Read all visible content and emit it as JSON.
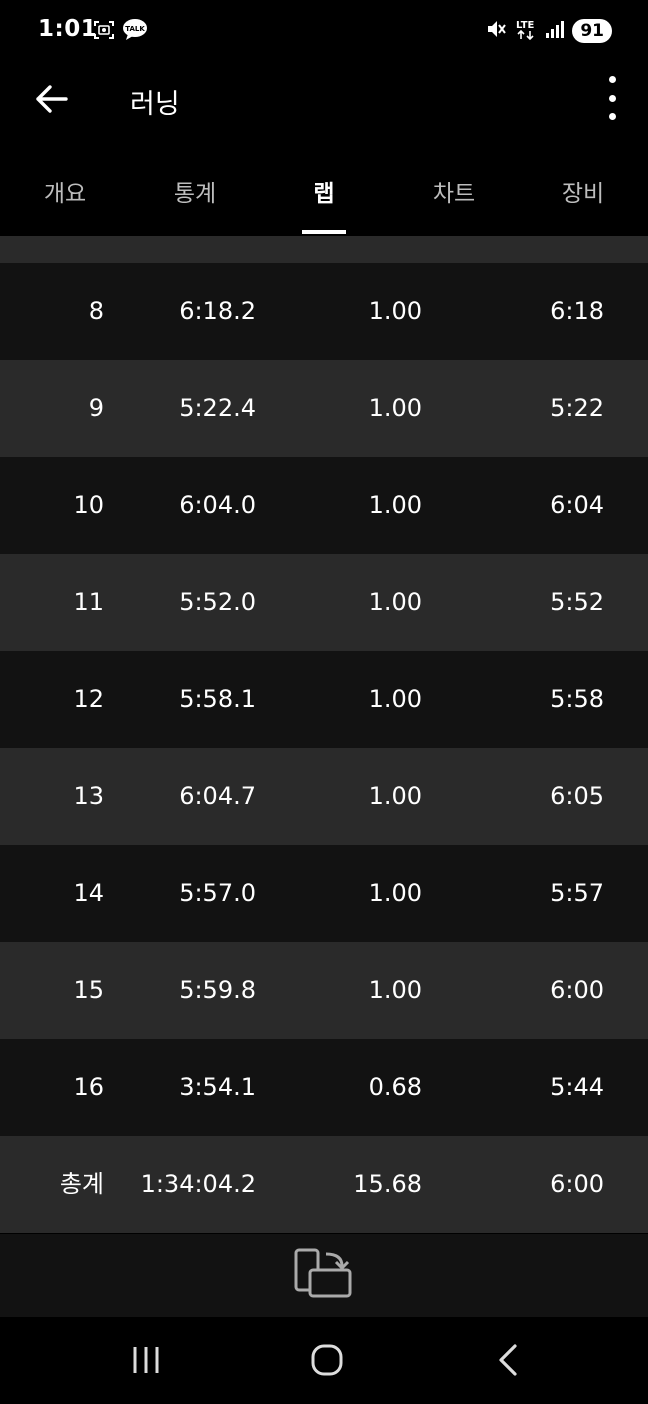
{
  "status_bar": {
    "time": "1:01",
    "battery": "91",
    "network": "LTE"
  },
  "app_bar": {
    "title": "러닝"
  },
  "tabs": [
    {
      "label": "개요",
      "active": false
    },
    {
      "label": "통계",
      "active": false
    },
    {
      "label": "랩",
      "active": true
    },
    {
      "label": "차트",
      "active": false
    },
    {
      "label": "장비",
      "active": false
    }
  ],
  "laps": [
    {
      "lap": "8",
      "time": "6:18.2",
      "distance": "1.00",
      "pace": "6:18"
    },
    {
      "lap": "9",
      "time": "5:22.4",
      "distance": "1.00",
      "pace": "5:22"
    },
    {
      "lap": "10",
      "time": "6:04.0",
      "distance": "1.00",
      "pace": "6:04"
    },
    {
      "lap": "11",
      "time": "5:52.0",
      "distance": "1.00",
      "pace": "5:52"
    },
    {
      "lap": "12",
      "time": "5:58.1",
      "distance": "1.00",
      "pace": "5:58"
    },
    {
      "lap": "13",
      "time": "6:04.7",
      "distance": "1.00",
      "pace": "6:05"
    },
    {
      "lap": "14",
      "time": "5:57.0",
      "distance": "1.00",
      "pace": "5:57"
    },
    {
      "lap": "15",
      "time": "5:59.8",
      "distance": "1.00",
      "pace": "6:00"
    },
    {
      "lap": "16",
      "time": "3:54.1",
      "distance": "0.68",
      "pace": "5:44"
    }
  ],
  "total": {
    "lap": "총계",
    "time": "1:34:04.2",
    "distance": "15.68",
    "pace": "6:00"
  },
  "colors": {
    "background": "#000000",
    "row_dark": "#121212",
    "row_light": "#2a2a2a",
    "text": "#ffffff",
    "tab_inactive": "#bdbdbd"
  }
}
